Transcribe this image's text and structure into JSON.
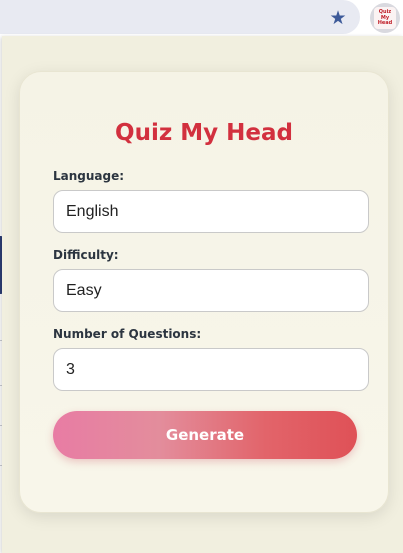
{
  "browser": {
    "bookmark_icon": "star-icon",
    "extension": {
      "icon": "quiz-my-head-logo",
      "logo_text": "Quiz My Head"
    }
  },
  "popup": {
    "title": "Quiz My Head",
    "fields": [
      {
        "label": "Language:",
        "value": "English"
      },
      {
        "label": "Difficulty:",
        "value": "Easy"
      },
      {
        "label": "Number of Questions:",
        "value": "3"
      }
    ],
    "generate_label": "Generate"
  },
  "colors": {
    "title": "#d2303e",
    "button_gradient_start": "#e87ca4",
    "button_gradient_end": "#df5157",
    "popup_background": "#f1efdf"
  }
}
